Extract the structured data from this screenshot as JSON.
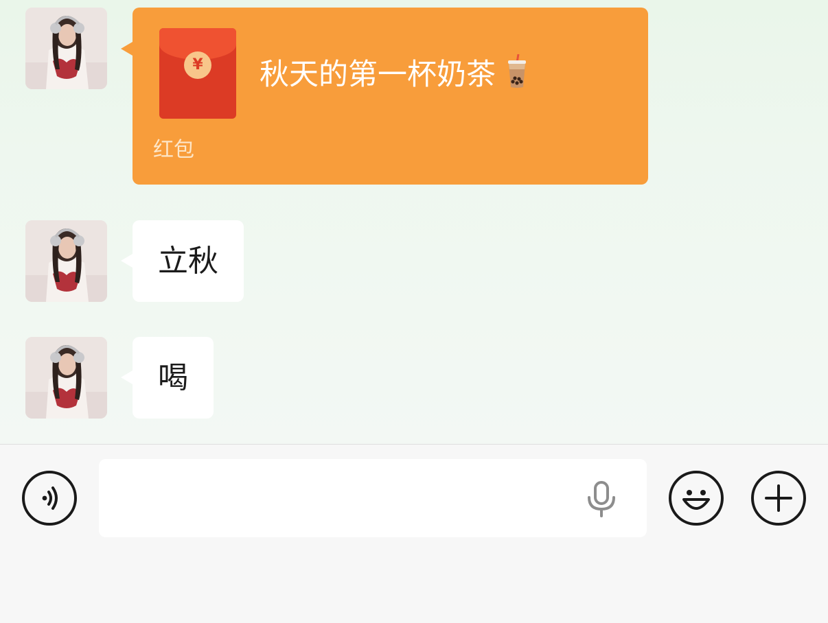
{
  "colors": {
    "chat_background": "#eef7ef",
    "red_packet_bubble": "#f89d3b",
    "red_packet_envelope": "#dc3b25",
    "text_bubble": "#ffffff",
    "input_bar_background": "#f7f7f7"
  },
  "messages": [
    {
      "type": "red_packet",
      "sender_avatar": "avatar-photo",
      "title": "秋天的第一杯奶茶",
      "emoji_icon": "bubble-tea-icon",
      "coin_symbol": "¥",
      "label": "红包"
    },
    {
      "type": "text",
      "sender_avatar": "avatar-photo",
      "text": "立秋"
    },
    {
      "type": "text",
      "sender_avatar": "avatar-photo",
      "text": "喝"
    }
  ],
  "input_bar": {
    "voice_toggle_icon": "voice-wave-icon",
    "input_value": "",
    "input_placeholder": "",
    "mic_icon": "microphone-icon",
    "emoji_icon": "smiley-icon",
    "more_icon": "plus-icon"
  }
}
